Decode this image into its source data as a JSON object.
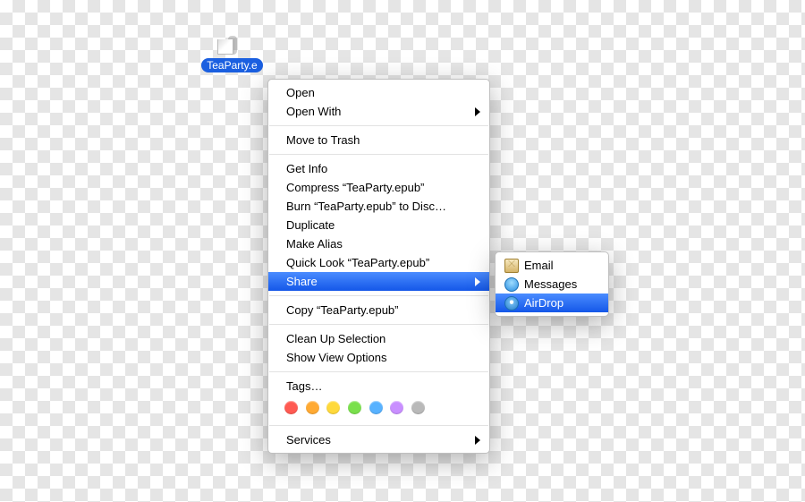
{
  "file": {
    "label": "TeaParty.e"
  },
  "menu": {
    "open": "Open",
    "open_with": "Open With",
    "move_to_trash": "Move to Trash",
    "get_info": "Get Info",
    "compress": "Compress “TeaParty.epub”",
    "burn": "Burn “TeaParty.epub” to Disc…",
    "duplicate": "Duplicate",
    "make_alias": "Make Alias",
    "quick_look": "Quick Look “TeaParty.epub”",
    "share": "Share",
    "copy": "Copy “TeaParty.epub”",
    "clean_up": "Clean Up Selection",
    "view_options": "Show View Options",
    "tags": "Tags…",
    "services": "Services"
  },
  "tags": {
    "colors": [
      "#ff5a52",
      "#ffaa33",
      "#ffd93b",
      "#7ae04c",
      "#58b2ff",
      "#c98fff",
      "#b9b9b9"
    ]
  },
  "share_menu": {
    "email": "Email",
    "messages": "Messages",
    "airdrop": "AirDrop"
  }
}
